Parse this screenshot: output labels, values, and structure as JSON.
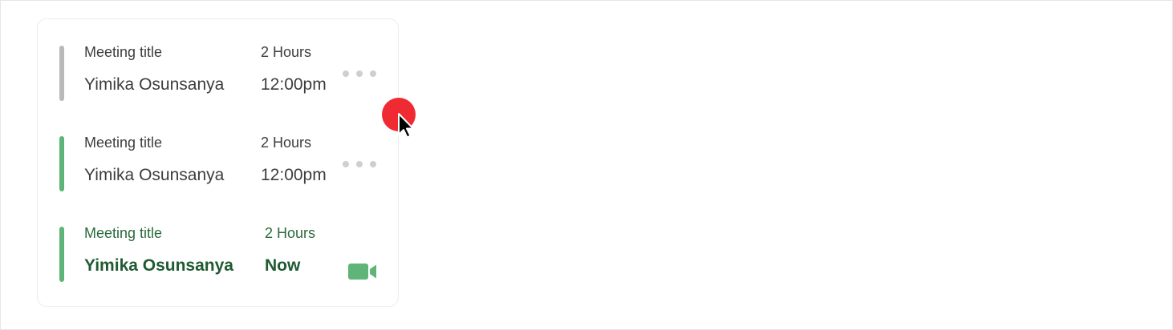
{
  "meetings": [
    {
      "title": "Meeting title",
      "attendee": "Yimika Osunsanya",
      "duration": "2 Hours",
      "time": "12:00pm",
      "status_color": "#b9b9b9",
      "action_icon": "more-horizontal-icon"
    },
    {
      "title": "Meeting title",
      "attendee": "Yimika Osunsanya",
      "duration": "2 Hours",
      "time": "12:00pm",
      "status_color": "#5fb477",
      "action_icon": "more-horizontal-icon"
    },
    {
      "title": "Meeting title",
      "attendee": "Yimika Osunsanya",
      "duration": "2 Hours",
      "time": "Now",
      "status_color": "#5fb477",
      "action_icon": "video-camera-icon"
    }
  ],
  "colors": {
    "accent_green": "#5fb477",
    "live_text_green": "#1f5a31",
    "click_indicator": "#f02a32"
  }
}
